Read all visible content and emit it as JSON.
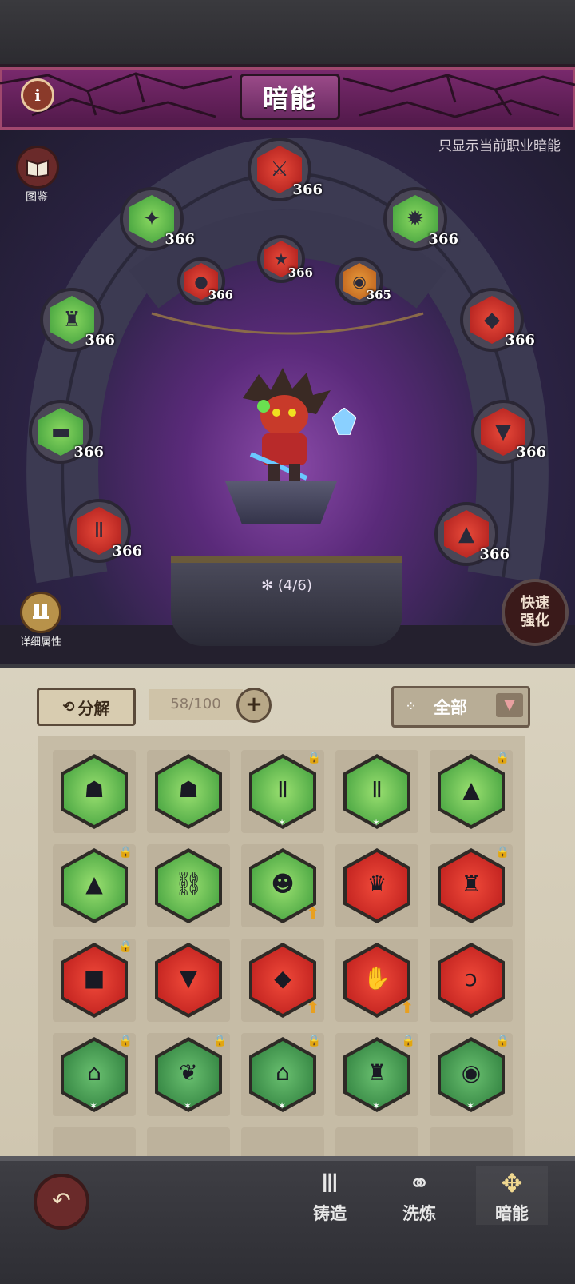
{
  "header": {
    "title": "暗能",
    "info_label": "i"
  },
  "scene": {
    "filter_text": "只显示当前职业暗能",
    "codex_label": "图鉴",
    "detail_label": "详细属性",
    "quick_label": "快速强化",
    "set_progress": "(4/6)",
    "slots": [
      {
        "level": "366",
        "tier": "red",
        "icon": "sword-icon"
      },
      {
        "level": "366",
        "tier": "green",
        "icon": "bat-icon"
      },
      {
        "level": "366",
        "tier": "green",
        "icon": "beast-icon"
      },
      {
        "level": "366",
        "tier": "red",
        "icon": "orb-icon"
      },
      {
        "level": "366",
        "tier": "red",
        "icon": "star-icon"
      },
      {
        "level": "365",
        "tier": "orange",
        "icon": "helm-icon"
      },
      {
        "level": "366",
        "tier": "green",
        "icon": "robe-icon"
      },
      {
        "level": "366",
        "tier": "red",
        "icon": "gauntlet-icon"
      },
      {
        "level": "366",
        "tier": "green",
        "icon": "belt-icon"
      },
      {
        "level": "366",
        "tier": "red",
        "icon": "boots-icon"
      },
      {
        "level": "366",
        "tier": "red",
        "icon": "pants-icon"
      },
      {
        "level": "366",
        "tier": "red",
        "icon": "armor-icon"
      }
    ]
  },
  "inventory": {
    "decompose_label": "分解",
    "capacity": "58/100",
    "filter_value": "全部",
    "items": [
      {
        "tier": "green",
        "icon": "helmet-icon",
        "locked": false,
        "upgrade": false
      },
      {
        "tier": "green",
        "icon": "helmet-icon",
        "locked": false,
        "upgrade": false
      },
      {
        "tier": "green",
        "icon": "pants-icon",
        "locked": true,
        "upgrade": false
      },
      {
        "tier": "green",
        "icon": "pants-icon",
        "locked": false,
        "upgrade": false
      },
      {
        "tier": "green",
        "icon": "armor-icon",
        "locked": true,
        "upgrade": false
      },
      {
        "tier": "green",
        "icon": "armor-icon",
        "locked": true,
        "upgrade": false
      },
      {
        "tier": "green",
        "icon": "chain-icon",
        "locked": false,
        "upgrade": false
      },
      {
        "tier": "green",
        "icon": "mask-icon",
        "locked": false,
        "upgrade": true
      },
      {
        "tier": "red",
        "icon": "crown-icon",
        "locked": false,
        "upgrade": false
      },
      {
        "tier": "red",
        "icon": "robe-icon",
        "locked": true,
        "upgrade": false
      },
      {
        "tier": "red",
        "icon": "box-icon",
        "locked": true,
        "upgrade": false
      },
      {
        "tier": "red",
        "icon": "boots-icon",
        "locked": false,
        "upgrade": false
      },
      {
        "tier": "red",
        "icon": "gauntlet-icon",
        "locked": false,
        "upgrade": true
      },
      {
        "tier": "red",
        "icon": "glove-icon",
        "locked": false,
        "upgrade": true
      },
      {
        "tier": "red",
        "icon": "necklace-icon",
        "locked": false,
        "upgrade": false
      },
      {
        "tier": "dgreen",
        "icon": "cloak-icon",
        "locked": true,
        "upgrade": false
      },
      {
        "tier": "dgreen",
        "icon": "wing-icon",
        "locked": true,
        "upgrade": false
      },
      {
        "tier": "dgreen",
        "icon": "cloak-icon",
        "locked": true,
        "upgrade": false
      },
      {
        "tier": "dgreen",
        "icon": "robe-icon",
        "locked": true,
        "upgrade": false
      },
      {
        "tier": "dgreen",
        "icon": "helm-icon",
        "locked": true,
        "upgrade": false
      }
    ]
  },
  "nav": {
    "tabs": [
      {
        "label": "铸造",
        "icon": "anvil-icon"
      },
      {
        "label": "洗炼",
        "icon": "triple-ring-icon"
      },
      {
        "label": "暗能",
        "icon": "dark-energy-icon"
      }
    ],
    "active": "暗能"
  },
  "colors": {
    "title_bg": "#6a2260",
    "panel_bg": "#d8d0bc",
    "nav_bg": "#36363c",
    "upgrade_arrow": "#e8a020"
  }
}
